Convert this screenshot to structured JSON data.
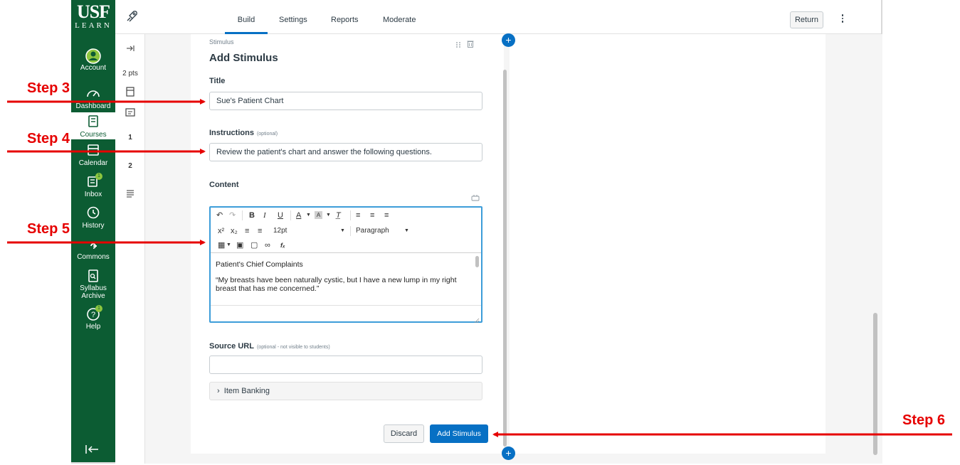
{
  "logo": {
    "line1": "USF",
    "line2": "LEARN"
  },
  "global_nav": {
    "items": [
      {
        "id": "account",
        "label": "Account",
        "icon": "avatar-icon"
      },
      {
        "id": "dashboard",
        "label": "Dashboard",
        "icon": "dashboard-icon"
      },
      {
        "id": "courses",
        "label": "Courses",
        "icon": "book-icon",
        "active": true
      },
      {
        "id": "calendar",
        "label": "Calendar",
        "icon": "calendar-icon"
      },
      {
        "id": "inbox",
        "label": "Inbox",
        "icon": "inbox-icon",
        "badge": "1"
      },
      {
        "id": "history",
        "label": "History",
        "icon": "clock-icon"
      },
      {
        "id": "commons",
        "label": "Commons",
        "icon": "commons-icon"
      },
      {
        "id": "syllabus",
        "label": "Syllabus Archive",
        "icon": "archive-icon"
      },
      {
        "id": "help",
        "label": "Help",
        "icon": "help-icon",
        "badge": "1"
      }
    ]
  },
  "item_tray": {
    "points": "2 pts",
    "numbers": [
      "1",
      "2"
    ]
  },
  "toolbar": {
    "tabs": [
      "Build",
      "Settings",
      "Reports",
      "Moderate"
    ],
    "active_tab": "Build",
    "return_label": "Return"
  },
  "stimulus": {
    "section_label": "Stimulus",
    "heading": "Add Stimulus",
    "title_label": "Title",
    "title_value": "Sue's Patient Chart",
    "instructions_label": "Instructions",
    "instructions_optional": "(optional)",
    "instructions_value": "Review the patient's chart and answer the following questions.",
    "content_label": "Content",
    "editor": {
      "font_size": "12pt",
      "block_format": "Paragraph",
      "heading_text": "Patient's Chief Complaints",
      "body_text": "“My breasts have been naturally cystic, but I have a new lump in my right breast that has me concerned.”"
    },
    "source_label": "Source URL",
    "source_optional": "(optional - not visible to students)",
    "source_value": "",
    "item_banking_label": "Item Banking",
    "discard_label": "Discard",
    "add_label": "Add Stimulus"
  },
  "annotations": {
    "step3": "Step 3",
    "step4": "Step 4",
    "step5": "Step 5",
    "step6": "Step 6",
    "color": "#e60000"
  },
  "colors": {
    "nav_green": "#0c5c33",
    "accent_blue": "#0770c4",
    "badge_green": "#8dc63f"
  }
}
